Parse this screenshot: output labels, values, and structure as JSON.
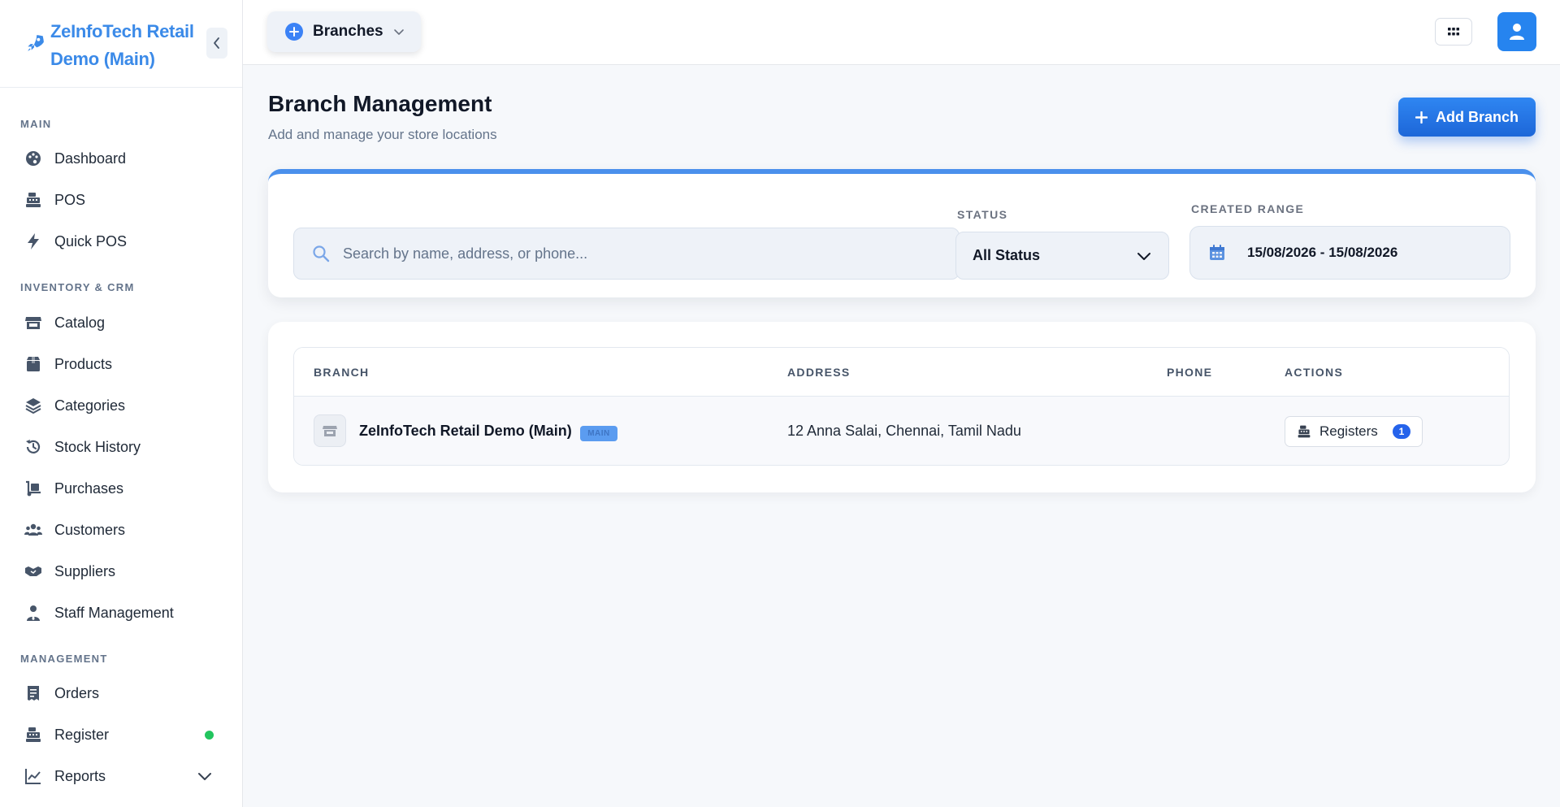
{
  "brand": {
    "title": "ZeInfoTech Retail Demo (Main)",
    "icon": "rocket-icon",
    "color": "#3b8ae8"
  },
  "sidebar": {
    "sections": [
      {
        "label": "MAIN",
        "items": [
          {
            "label": "Dashboard",
            "icon": "palette-icon"
          },
          {
            "label": "POS",
            "icon": "cash-register-icon"
          },
          {
            "label": "Quick POS",
            "icon": "bolt-icon"
          }
        ]
      },
      {
        "label": "INVENTORY & CRM",
        "items": [
          {
            "label": "Catalog",
            "icon": "store-icon"
          },
          {
            "label": "Products",
            "icon": "box-icon"
          },
          {
            "label": "Categories",
            "icon": "layers-icon"
          },
          {
            "label": "Stock History",
            "icon": "history-icon"
          },
          {
            "label": "Purchases",
            "icon": "dolly-icon"
          },
          {
            "label": "Customers",
            "icon": "users-icon"
          },
          {
            "label": "Suppliers",
            "icon": "handshake-icon"
          },
          {
            "label": "Staff Management",
            "icon": "user-tie-icon"
          }
        ]
      },
      {
        "label": "MANAGEMENT",
        "items": [
          {
            "label": "Orders",
            "icon": "receipt-icon"
          },
          {
            "label": "Register",
            "icon": "cash-register-icon",
            "status": "online"
          },
          {
            "label": "Reports",
            "icon": "chart-line-icon",
            "expandable": true
          }
        ]
      }
    ]
  },
  "topbar": {
    "branches_label": "Branches"
  },
  "page": {
    "title": "Branch Management",
    "subtitle": "Add and manage your store locations",
    "add_button": "Add Branch"
  },
  "filters": {
    "search_placeholder": "Search by name, address, or phone...",
    "status_label": "STATUS",
    "status_value": "All Status",
    "range_label": "CREATED RANGE",
    "range_value": "15/08/2026 - 15/08/2026"
  },
  "table": {
    "headers": {
      "branch": "BRANCH",
      "address": "ADDRESS",
      "phone": "PHONE",
      "actions": "ACTIONS"
    },
    "rows": [
      {
        "name": "ZeInfoTech Retail Demo (Main)",
        "badge": "MAIN",
        "address": "12 Anna Salai, Chennai, Tamil Nadu",
        "phone": "",
        "registers_label": "Registers",
        "registers_count": "1"
      }
    ]
  },
  "colors": {
    "accent": "#2684ef",
    "online": "#22c55e",
    "topbar_accent": "#4a90ec"
  }
}
